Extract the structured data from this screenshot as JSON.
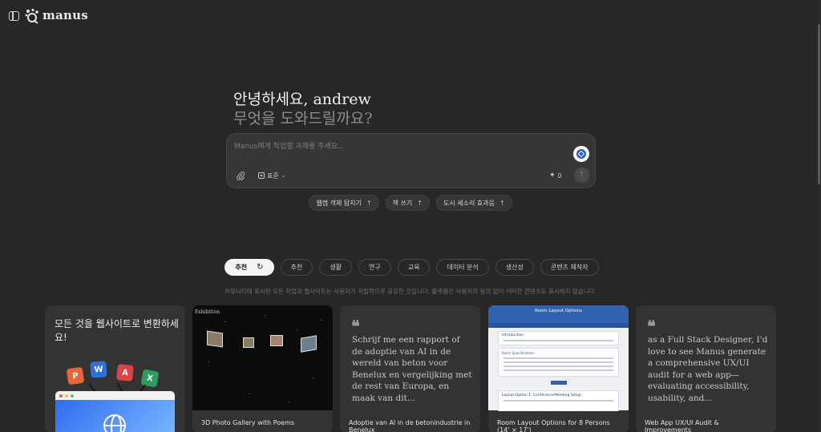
{
  "app": {
    "name": "manus"
  },
  "hero": {
    "greeting": "안녕하세요, andrew",
    "subtitle": "무엇을 도와드릴까요?"
  },
  "composer": {
    "placeholder": "Manus에게 작업할 과제를 주세요...",
    "mode_label": "표준",
    "credits": "0"
  },
  "suggestions": [
    {
      "label": "웹캠 객체 탐지기"
    },
    {
      "label": "책 쓰기"
    },
    {
      "label": "도시 세소리 효과음"
    }
  ],
  "categories": [
    {
      "label": "추천",
      "active": true
    },
    {
      "label": "추천"
    },
    {
      "label": "생활"
    },
    {
      "label": "연구"
    },
    {
      "label": "교육"
    },
    {
      "label": "데이터 분석"
    },
    {
      "label": "생산성"
    },
    {
      "label": "콘텐츠 제작자"
    }
  ],
  "disclaimer": "커뮤니티에 표시된 모든 작업과 웹사이트는 사용자가 자발적으로 공유한 것입니다. 플랫폼은 사용자의 동의 없이 어떠한 콘텐츠도 표시하지 않습니다.",
  "cards": {
    "website": {
      "title": "모든 것을 웹사이트로 변환하세요!",
      "tiles": [
        "P",
        "W",
        "A",
        "X"
      ]
    },
    "gallery": {
      "thumb_label": "Exhibition",
      "caption": "3D Photo Gallery with Poems"
    },
    "dutch": {
      "quote": "Schrijf me een rapport of de adoptie van AI in de wereld van beton voor Benelux en vergelijking met de rest van Europa, en maak van dit...",
      "caption": "Adoptie van AI in de betonindustrie in Benelux"
    },
    "room": {
      "thumb_title": "Room Layout Options",
      "section_intro": "Introduction",
      "section_specs": "Room Specifications",
      "section_option": "Layout Option 1: Conference/Meeting Setup",
      "caption": "Room Layout Options for 8 Persons (14' × 17')"
    },
    "uxaudit": {
      "quote": "as a Full Stack Designer, I'd love to see Manus generate a comprehensive UX/UI audit for a web app—evaluating accessibility, usability, and...",
      "caption": "Web App UX/UI Audit & Improvements"
    }
  },
  "colors": {
    "background": "#272727",
    "accent_blue": "#2c5bd3"
  }
}
